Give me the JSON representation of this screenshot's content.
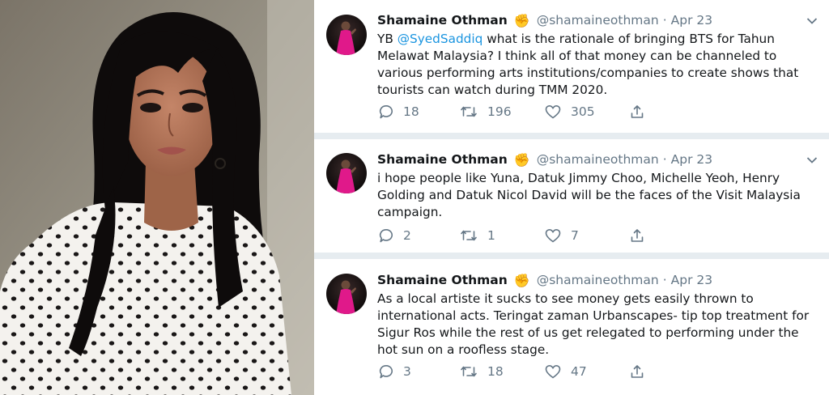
{
  "tweets": [
    {
      "name": "Shamaine Othman",
      "handle": "@shamaineothman",
      "separator": "·",
      "date": "Apr 23",
      "text_before": "YB ",
      "mention": "@SyedSaddiq",
      "text_after": " what is the rationale of bringing BTS for Tahun Melawat Malaysia? I think all of that money can be channeled to various performing arts institutions/companies to create shows that tourists can watch during TMM 2020.",
      "replies": "18",
      "retweets": "196",
      "likes": "305"
    },
    {
      "name": "Shamaine Othman",
      "handle": "@shamaineothman",
      "separator": "·",
      "date": "Apr 23",
      "text": "i hope people like Yuna, Datuk Jimmy Choo, Michelle Yeoh, Henry Golding and Datuk Nicol David will be the faces of the Visit Malaysia campaign.",
      "replies": "2",
      "retweets": "1",
      "likes": "7"
    },
    {
      "name": "Shamaine Othman",
      "handle": "@shamaineothman",
      "separator": "·",
      "date": "Apr 23",
      "text": "As a local artiste it sucks to see money gets easily thrown to international acts. Teringat zaman Urbanscapes- tip top treatment for Sigur Ros while the rest of us get relegated to performing under the hot sun on a roofless stage.",
      "replies": "3",
      "retweets": "18",
      "likes": "47"
    }
  ],
  "colors": {
    "name": "#14171a",
    "meta": "#657786",
    "mention": "#1b95e0",
    "feed_background": "#e6ecf0",
    "avatar_dress": "#e0198a"
  },
  "icons": [
    "reply-icon",
    "retweet-icon",
    "like-icon",
    "share-icon",
    "chevron-down-icon",
    "raised-fist-emoji"
  ]
}
